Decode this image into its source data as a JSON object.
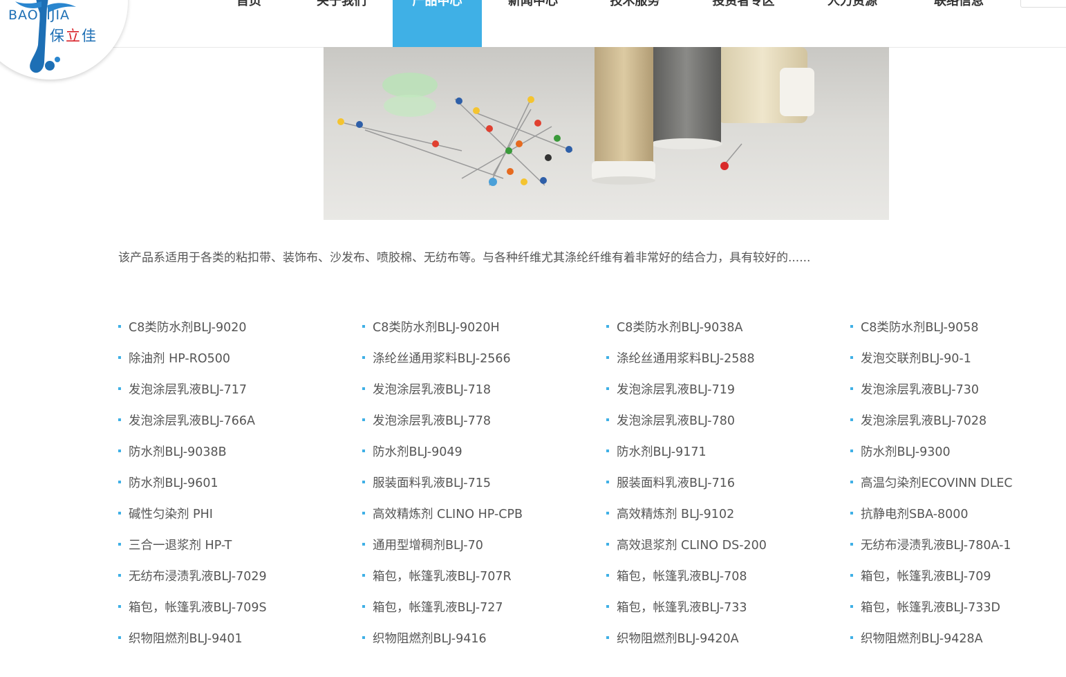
{
  "logo": {
    "en": "BAOLIJIA",
    "cn_a": "保",
    "cn_b": "立",
    "cn_c": "佳"
  },
  "nav": {
    "items": [
      {
        "label": "首页"
      },
      {
        "label": "关于我们"
      },
      {
        "label": "产品中心"
      },
      {
        "label": "新闻中心"
      },
      {
        "label": "技术服务"
      },
      {
        "label": "投资者专区"
      },
      {
        "label": "人力资源"
      },
      {
        "label": "联络信息"
      }
    ],
    "active_index": 2
  },
  "description": "该产品系适用于各类的粘扣带、装饰布、沙发布、喷胶棉、无纺布等。与各种纤维尤其涤纶纤维有着非常好的结合力，具有较好的......",
  "products": [
    "C8类防水剂BLJ-9020",
    "C8类防水剂BLJ-9020H",
    "C8类防水剂BLJ-9038A",
    "C8类防水剂BLJ-9058",
    "除油剂 HP-RO500",
    "涤纶丝通用浆料BLJ-2566",
    "涤纶丝通用浆料BLJ-2588",
    "发泡交联剂BLJ-90-1",
    "发泡涂层乳液BLJ-717",
    "发泡涂层乳液BLJ-718",
    "发泡涂层乳液BLJ-719",
    "发泡涂层乳液BLJ-730",
    "发泡涂层乳液BLJ-766A",
    "发泡涂层乳液BLJ-778",
    "发泡涂层乳液BLJ-780",
    "发泡涂层乳液BLJ-7028",
    "防水剂BLJ-9038B",
    "防水剂BLJ-9049",
    "防水剂BLJ-9171",
    "防水剂BLJ-9300",
    "防水剂BLJ-9601",
    "服装面料乳液BLJ-715",
    "服装面料乳液BLJ-716",
    "高温匀染剂ECOVINN DLEC",
    "碱性匀染剂 PHI",
    "高效精炼剂 CLINO HP-CPB",
    "高效精炼剂 BLJ-9102",
    "抗静电剂SBA-8000",
    "三合一退浆剂 HP-T",
    "通用型增稠剂BLJ-70",
    "高效退浆剂 CLINO DS-200",
    "无纺布浸渍乳液BLJ-780A-1",
    "无纺布浸渍乳液BLJ-7029",
    "箱包，帐篷乳液BLJ-707R",
    "箱包，帐篷乳液BLJ-708",
    "箱包，帐篷乳液BLJ-709",
    "箱包，帐篷乳液BLJ-709S",
    "箱包，帐篷乳液BLJ-727",
    "箱包，帐篷乳液BLJ-733",
    "箱包，帐篷乳液BLJ-733D",
    "织物阻燃剂BLJ-9401",
    "织物阻燃剂BLJ-9416",
    "织物阻燃剂BLJ-9420A",
    "织物阻燃剂BLJ-9428A"
  ],
  "colors": {
    "accent": "#3fb0e6",
    "logo_blue": "#1d6fb5",
    "logo_red": "#d9232a",
    "text": "#555555"
  }
}
